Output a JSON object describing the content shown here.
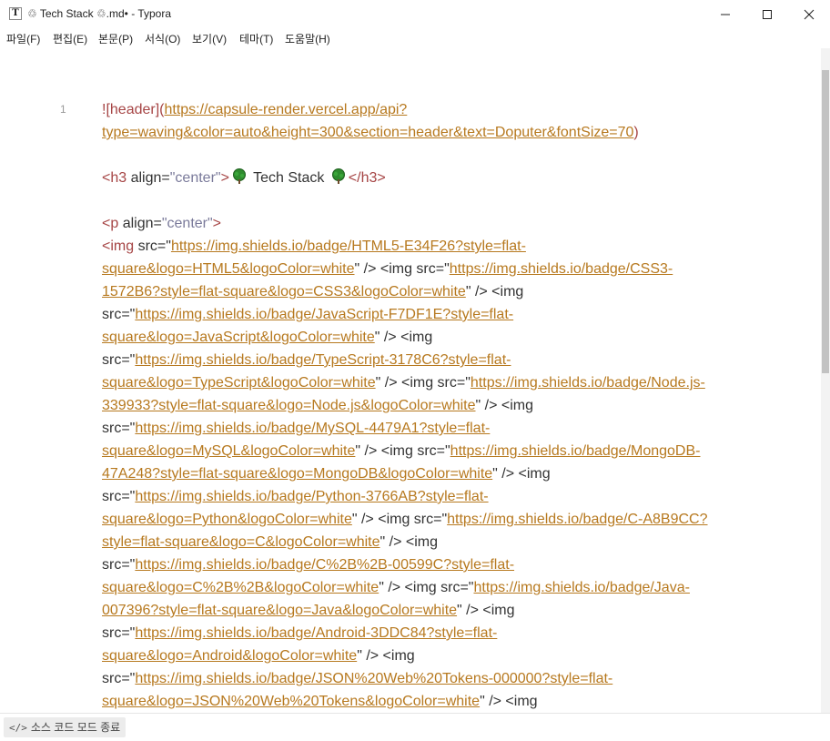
{
  "window": {
    "app_icon_letter": "T",
    "title": "♲ Tech Stack ♲.md• - Typora",
    "buttons": [
      "minimize",
      "maximize",
      "close"
    ]
  },
  "menu": {
    "items": [
      "파일(F)",
      "편집(E)",
      "본문(P)",
      "서식(O)",
      "보기(V)",
      "테마(T)",
      "도움말(H)"
    ]
  },
  "editor": {
    "line_number": "1",
    "lines": [
      {
        "segs": [
          {
            "t": "![header](",
            "c": "punc"
          },
          {
            "t": "https://capsule-render.vercel.app/api?",
            "c": "link"
          }
        ]
      },
      {
        "segs": [
          {
            "t": "type=waving&color=auto&height=300&section=header&text=Doputer&fontSize=70",
            "c": "link"
          },
          {
            "t": ")",
            "c": "punc"
          }
        ]
      },
      {
        "segs": []
      },
      {
        "segs": [
          {
            "t": "<h3 ",
            "c": "tag"
          },
          {
            "t": "align=",
            "c": "attr"
          },
          {
            "t": "\"center\"",
            "c": "str"
          },
          {
            "t": ">",
            "c": "tag"
          },
          {
            "t": "tree-icon",
            "c": "icon"
          },
          {
            "t": " Tech Stack ",
            "c": "plain"
          },
          {
            "t": "tree-icon",
            "c": "icon"
          },
          {
            "t": "</h3>",
            "c": "tag"
          }
        ]
      },
      {
        "segs": []
      },
      {
        "segs": [
          {
            "t": "<p ",
            "c": "tag"
          },
          {
            "t": "align=",
            "c": "attr"
          },
          {
            "t": "\"center\"",
            "c": "str"
          },
          {
            "t": ">",
            "c": "tag"
          }
        ]
      },
      {
        "segs": [
          {
            "t": "<img ",
            "c": "tag"
          },
          {
            "t": "src=\"",
            "c": "attr"
          },
          {
            "t": "https://img.shields.io/badge/HTML5-E34F26?style=flat-",
            "c": "link"
          }
        ]
      },
      {
        "segs": [
          {
            "t": "square&logo=HTML5&logoColor=white",
            "c": "link"
          },
          {
            "t": "\" /> <img src=\"",
            "c": "attr"
          },
          {
            "t": "https://img.shields.io/badge/CSS3-",
            "c": "link"
          }
        ]
      },
      {
        "segs": [
          {
            "t": "1572B6?style=flat-square&logo=CSS3&logoColor=white",
            "c": "link"
          },
          {
            "t": "\" /> <img",
            "c": "attr"
          }
        ]
      },
      {
        "segs": [
          {
            "t": "src=\"",
            "c": "attr"
          },
          {
            "t": "https://img.shields.io/badge/JavaScript-F7DF1E?style=flat-",
            "c": "link"
          }
        ]
      },
      {
        "segs": [
          {
            "t": "square&logo=JavaScript&logoColor=white",
            "c": "link"
          },
          {
            "t": "\" /> <img",
            "c": "attr"
          }
        ]
      },
      {
        "segs": [
          {
            "t": "src=\"",
            "c": "attr"
          },
          {
            "t": "https://img.shields.io/badge/TypeScript-3178C6?style=flat-",
            "c": "link"
          }
        ]
      },
      {
        "segs": [
          {
            "t": "square&logo=TypeScript&logoColor=white",
            "c": "link"
          },
          {
            "t": "\" /> <img src=\"",
            "c": "attr"
          },
          {
            "t": "https://img.shields.io/badge/Node.js-",
            "c": "link"
          }
        ]
      },
      {
        "segs": [
          {
            "t": "339933?style=flat-square&logo=Node.js&logoColor=white",
            "c": "link"
          },
          {
            "t": "\" /> <img",
            "c": "attr"
          }
        ]
      },
      {
        "segs": [
          {
            "t": "src=\"",
            "c": "attr"
          },
          {
            "t": "https://img.shields.io/badge/MySQL-4479A1?style=flat-",
            "c": "link"
          }
        ]
      },
      {
        "segs": [
          {
            "t": "square&logo=MySQL&logoColor=white",
            "c": "link"
          },
          {
            "t": "\" /> <img src=\"",
            "c": "attr"
          },
          {
            "t": "https://img.shields.io/badge/MongoDB-",
            "c": "link"
          }
        ]
      },
      {
        "segs": [
          {
            "t": "47A248?style=flat-square&logo=MongoDB&logoColor=white",
            "c": "link"
          },
          {
            "t": "\" /> <img",
            "c": "attr"
          }
        ]
      },
      {
        "segs": [
          {
            "t": "src=\"",
            "c": "attr"
          },
          {
            "t": "https://img.shields.io/badge/Python-3766AB?style=flat-",
            "c": "link"
          }
        ]
      },
      {
        "segs": [
          {
            "t": "square&logo=Python&logoColor=white",
            "c": "link"
          },
          {
            "t": "\" /> <img src=\"",
            "c": "attr"
          },
          {
            "t": "https://img.shields.io/badge/C-A8B9CC?",
            "c": "link"
          }
        ]
      },
      {
        "segs": [
          {
            "t": "style=flat-square&logo=C&logoColor=white",
            "c": "link"
          },
          {
            "t": "\" /> <img",
            "c": "attr"
          }
        ]
      },
      {
        "segs": [
          {
            "t": "src=\"",
            "c": "attr"
          },
          {
            "t": "https://img.shields.io/badge/C%2B%2B-00599C?style=flat-",
            "c": "link"
          }
        ]
      },
      {
        "segs": [
          {
            "t": "square&logo=C%2B%2B&logoColor=white",
            "c": "link"
          },
          {
            "t": "\" /> <img src=\"",
            "c": "attr"
          },
          {
            "t": "https://img.shields.io/badge/Java-",
            "c": "link"
          }
        ]
      },
      {
        "segs": [
          {
            "t": "007396?style=flat-square&logo=Java&logoColor=white",
            "c": "link"
          },
          {
            "t": "\" /> <img",
            "c": "attr"
          }
        ]
      },
      {
        "segs": [
          {
            "t": "src=\"",
            "c": "attr"
          },
          {
            "t": "https://img.shields.io/badge/Android-3DDC84?style=flat-",
            "c": "link"
          }
        ]
      },
      {
        "segs": [
          {
            "t": "square&logo=Android&logoColor=white",
            "c": "link"
          },
          {
            "t": "\" /> <img",
            "c": "attr"
          }
        ]
      },
      {
        "segs": [
          {
            "t": "src=\"",
            "c": "attr"
          },
          {
            "t": "https://img.shields.io/badge/JSON%20Web%20Tokens-000000?style=flat-",
            "c": "link"
          }
        ]
      },
      {
        "segs": [
          {
            "t": "square&logo=JSON%20Web%20Tokens&logoColor=white",
            "c": "link"
          },
          {
            "t": "\" /> <img",
            "c": "attr"
          }
        ]
      }
    ]
  },
  "footer": {
    "source_mode_label": "소스 코드 모드 종료"
  },
  "colors": {
    "link": "#b7791f",
    "tag": "#a64545",
    "string": "#7a7a9a",
    "tree": "#2e8b2e"
  }
}
